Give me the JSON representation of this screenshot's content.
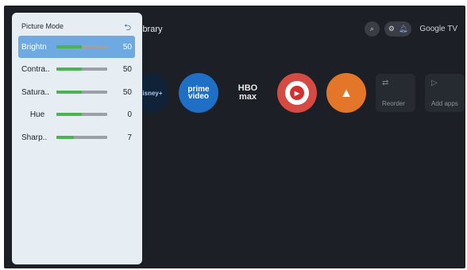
{
  "panel": {
    "title": "Picture Mode",
    "back_icon": "undo-icon",
    "settings": [
      {
        "label": "Brightn",
        "value": "50",
        "level": 0.5
      },
      {
        "label": "Contra..",
        "value": "50",
        "level": 0.5
      },
      {
        "label": "Satura..",
        "value": "50",
        "level": 0.5
      },
      {
        "label": "Hue",
        "value": "0",
        "level": 0.5
      },
      {
        "label": "Sharp..",
        "value": "7",
        "level": 0.35
      }
    ],
    "accent": "#4bb34f",
    "selected_bg": "#6fa9e2"
  },
  "home": {
    "section_title": "ibrary",
    "brand": "Google TV",
    "apps": [
      {
        "name": "disney+",
        "label": "isney+"
      },
      {
        "name": "prime video",
        "label_line1": "prime",
        "label_line2": "video"
      },
      {
        "name": "hbo max",
        "label_line1": "HBO",
        "label_line2": "max"
      },
      {
        "name": "youtube music",
        "label": "▶"
      },
      {
        "name": "vlc",
        "label": "▲"
      }
    ],
    "tiles": [
      {
        "label": "Reorder",
        "icon": "reorder-icon"
      },
      {
        "label": "Add apps",
        "icon": "play-store-icon"
      }
    ]
  }
}
